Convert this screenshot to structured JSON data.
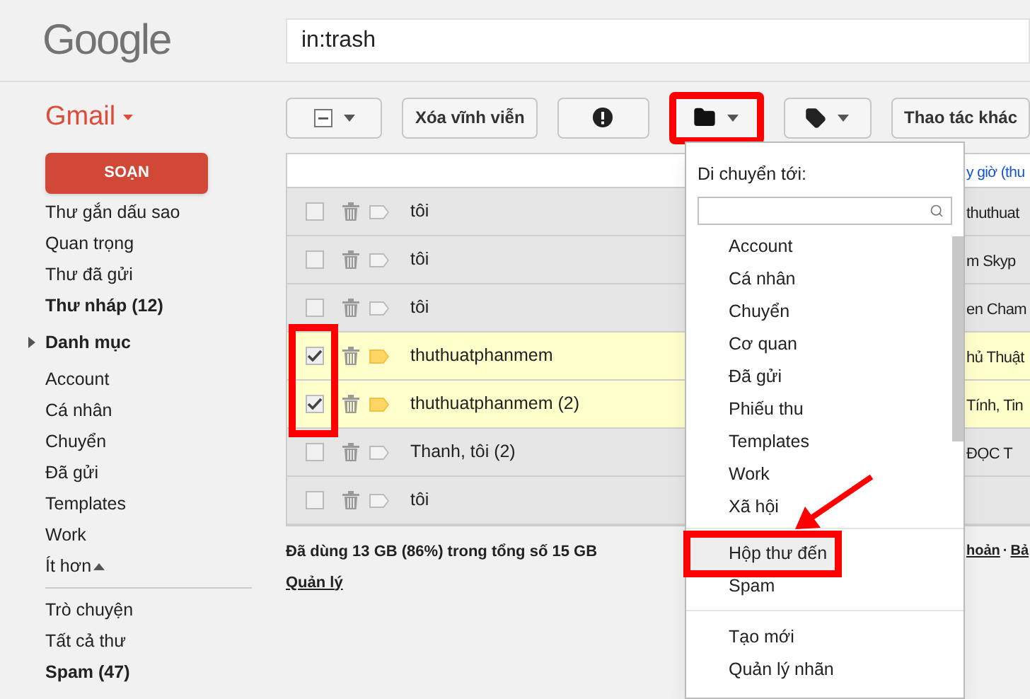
{
  "logo": "Google",
  "search": {
    "value": "in:trash"
  },
  "app_menu": "Gmail",
  "compose": "SOẠN",
  "sidebar": {
    "items": [
      {
        "kind": "item",
        "label": "Thư gắn dấu sao",
        "bold": false
      },
      {
        "kind": "item",
        "label": "Quan trọng",
        "bold": false
      },
      {
        "kind": "item",
        "label": "Thư đã gửi",
        "bold": false
      },
      {
        "kind": "item",
        "label": "Thư nháp (12)",
        "bold": true
      },
      {
        "kind": "category",
        "label": "Danh mục",
        "bold": true
      },
      {
        "kind": "item",
        "label": "Account",
        "bold": false
      },
      {
        "kind": "item",
        "label": "Cá nhân",
        "bold": false
      },
      {
        "kind": "item",
        "label": "Chuyển",
        "bold": false
      },
      {
        "kind": "item",
        "label": "Đã gửi",
        "bold": false
      },
      {
        "kind": "item",
        "label": "Templates",
        "bold": false
      },
      {
        "kind": "item",
        "label": "Work",
        "bold": false
      },
      {
        "kind": "less",
        "label": "Ít hơn",
        "bold": false
      },
      {
        "kind": "divider"
      },
      {
        "kind": "item",
        "label": "Trò chuyện",
        "bold": false
      },
      {
        "kind": "item",
        "label": "Tất cả thư",
        "bold": false
      },
      {
        "kind": "item",
        "label": "Spam (47)",
        "bold": true
      }
    ]
  },
  "toolbar": [
    {
      "kind": "select"
    },
    {
      "kind": "text",
      "label": "Xóa vĩnh viễn",
      "highlighted": false
    },
    {
      "kind": "spam",
      "highlighted": false
    },
    {
      "kind": "move",
      "highlighted": true
    },
    {
      "kind": "labels",
      "highlighted": false
    },
    {
      "kind": "text",
      "label": "Thao tác khác",
      "highlighted": false
    }
  ],
  "list_header": {
    "link": "y giờ (thu"
  },
  "rows": [
    {
      "sender": "tôi",
      "snippet": "thuthuat",
      "checked": false,
      "important": false
    },
    {
      "sender": "tôi",
      "snippet": "m Skyp",
      "checked": false,
      "important": false
    },
    {
      "sender": "tôi",
      "snippet": "en Cham",
      "checked": false,
      "important": false
    },
    {
      "sender": "thuthuatphanmem",
      "snippet": "hủ Thuật",
      "checked": true,
      "important": true
    },
    {
      "sender": "thuthuatphanmem (2)",
      "snippet": "Tính, Tin",
      "checked": true,
      "important": true
    },
    {
      "sender": "Thanh, tôi (2)",
      "snippet": "ĐỌC T",
      "checked": false,
      "important": false
    },
    {
      "sender": "tôi",
      "snippet": "",
      "checked": false,
      "important": false
    }
  ],
  "footer": {
    "usage": "Đã dùng 13 GB (86%) trong tổng số 15 GB",
    "manage": "Quản lý",
    "links": [
      "hoản",
      "Bả"
    ],
    "separator": "·"
  },
  "move_menu": {
    "title": "Di chuyển tới:",
    "labels": [
      {
        "label": "Account",
        "selected": false
      },
      {
        "label": "Cá nhân",
        "selected": false
      },
      {
        "label": "Chuyển",
        "selected": false
      },
      {
        "label": "Cơ quan",
        "selected": false
      },
      {
        "label": "Đã gửi",
        "selected": false
      },
      {
        "label": "Phiếu thu",
        "selected": false
      },
      {
        "label": "Templates",
        "selected": false
      },
      {
        "label": "Work",
        "selected": false
      },
      {
        "label": "Xã hội",
        "selected": false
      }
    ],
    "system": [
      {
        "label": "Hộp thư đến",
        "selected": true
      },
      {
        "label": "Spam",
        "selected": false
      }
    ],
    "actions": [
      "Tạo mới",
      "Quản lý nhãn"
    ]
  }
}
